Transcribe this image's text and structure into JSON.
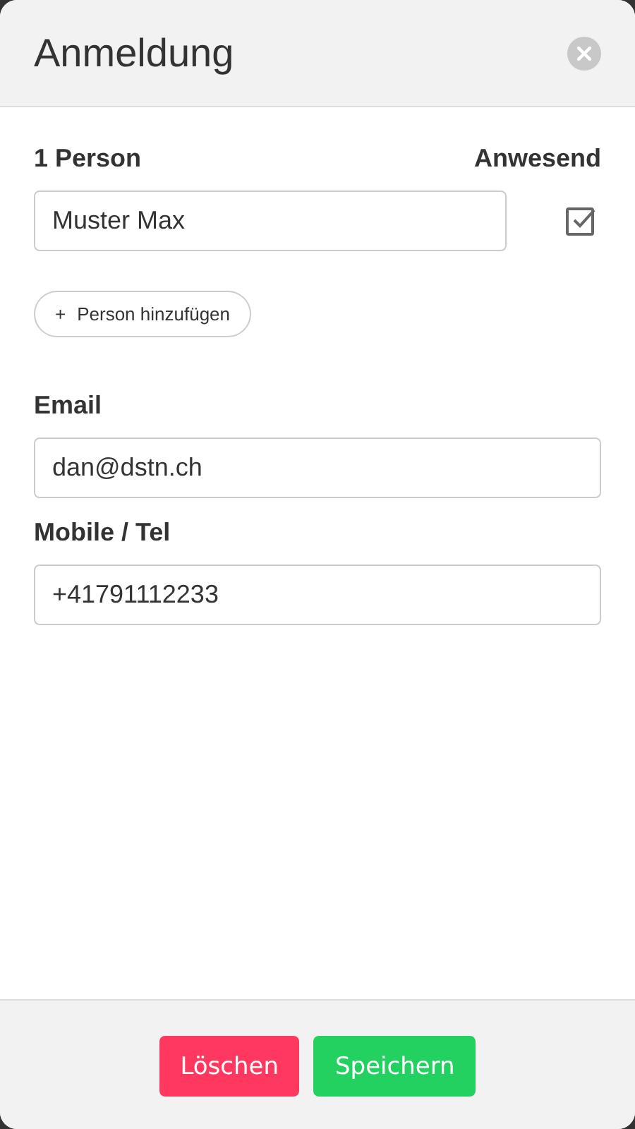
{
  "modal": {
    "title": "Anmeldung"
  },
  "persons": {
    "heading": "1 Person",
    "attendance_heading": "Anwesend",
    "rows": [
      {
        "name": "Muster Max",
        "checked": true
      }
    ],
    "add_button": {
      "icon": "+",
      "label": "Person hinzufügen"
    }
  },
  "fields": [
    {
      "label": "Email",
      "value": "dan@dstn.ch"
    },
    {
      "label": "Mobile / Tel",
      "value": "+41791112233"
    }
  ],
  "buttons": [
    {
      "label": "Löschen",
      "kind": "danger"
    },
    {
      "label": "Speichern",
      "kind": "success"
    }
  ]
}
